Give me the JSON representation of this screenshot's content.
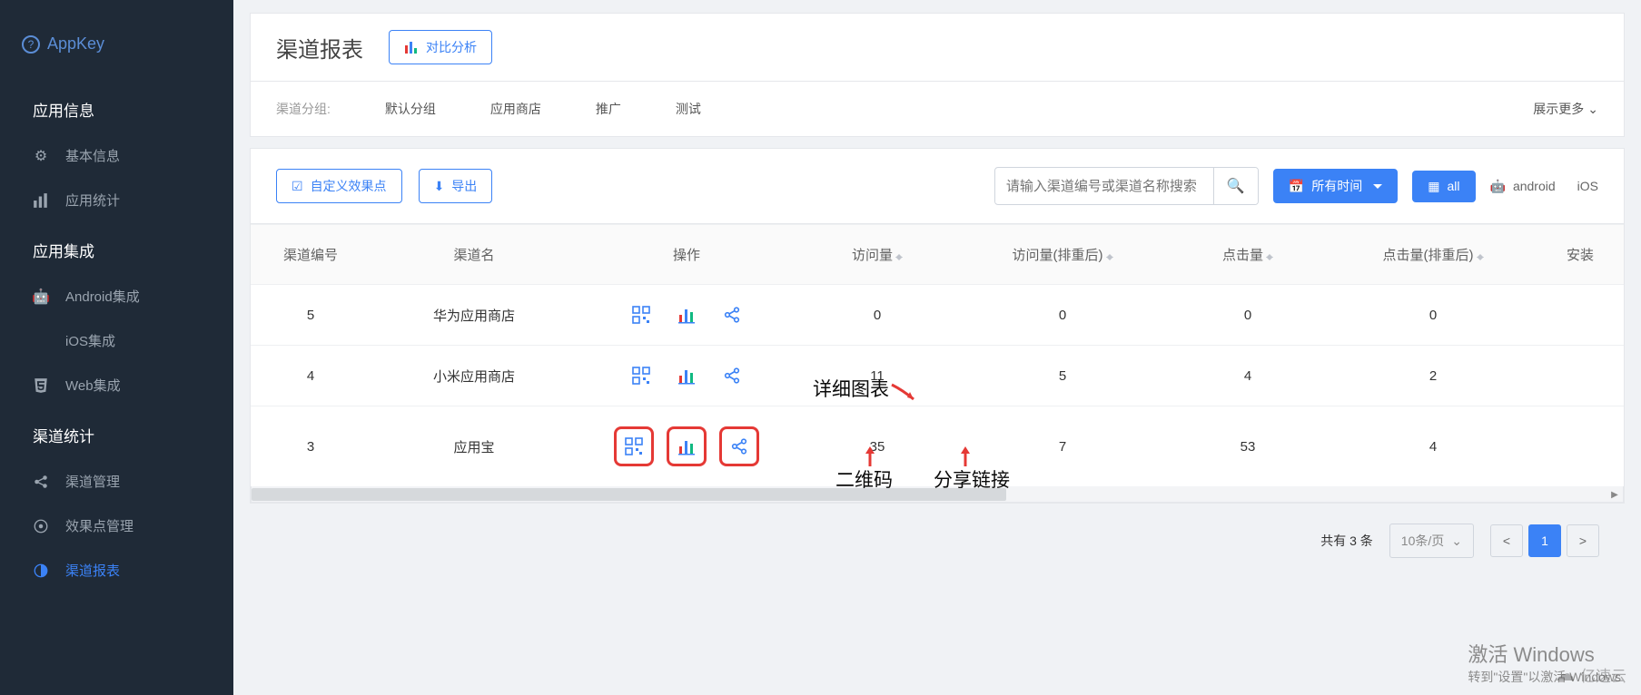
{
  "sidebar": {
    "appkey_label": "AppKey",
    "sections": [
      {
        "title": "应用信息",
        "items": [
          {
            "icon": "gear",
            "label": "基本信息"
          },
          {
            "icon": "bars",
            "label": "应用统计"
          }
        ]
      },
      {
        "title": "应用集成",
        "items": [
          {
            "icon": "android",
            "label": "Android集成"
          },
          {
            "icon": "apple",
            "label": "iOS集成"
          },
          {
            "icon": "html5",
            "label": "Web集成"
          }
        ]
      },
      {
        "title": "渠道统计",
        "items": [
          {
            "icon": "share",
            "label": "渠道管理"
          },
          {
            "icon": "target",
            "label": "效果点管理"
          },
          {
            "icon": "contrast",
            "label": "渠道报表",
            "active": true
          }
        ]
      }
    ]
  },
  "header": {
    "title": "渠道报表",
    "compare_btn": "对比分析"
  },
  "filter": {
    "label": "渠道分组:",
    "items": [
      "默认分组",
      "应用商店",
      "推广",
      "测试"
    ],
    "show_more": "展示更多"
  },
  "toolbar": {
    "custom_point": "自定义效果点",
    "export": "导出",
    "search_placeholder": "请输入渠道编号或渠道名称搜索",
    "all_time": "所有时间",
    "all": "all",
    "android": "android",
    "ios": "iOS"
  },
  "table": {
    "columns": [
      "渠道编号",
      "渠道名",
      "操作",
      "访问量",
      "访问量(排重后)",
      "点击量",
      "点击量(排重后)",
      "安装"
    ],
    "rows": [
      {
        "id": "5",
        "name": "华为应用商店",
        "visits": "0",
        "visits_uniq": "0",
        "clicks": "0",
        "clicks_uniq": "0"
      },
      {
        "id": "4",
        "name": "小米应用商店",
        "visits": "11",
        "visits_uniq": "5",
        "clicks": "4",
        "clicks_uniq": "2"
      },
      {
        "id": "3",
        "name": "应用宝",
        "visits": "35",
        "visits_uniq": "7",
        "clicks": "53",
        "clicks_uniq": "4",
        "highlight": true
      }
    ]
  },
  "annotations": {
    "detail_chart": "详细图表",
    "qr_code": "二维码",
    "share_link": "分享链接"
  },
  "pagination": {
    "total_text": "共有 3 条",
    "per_page": "10条/页",
    "current": "1"
  },
  "windows": {
    "line1": "激活 Windows",
    "line2": "转到\"设置\"以激活 Windows"
  },
  "watermark": "亿速云"
}
